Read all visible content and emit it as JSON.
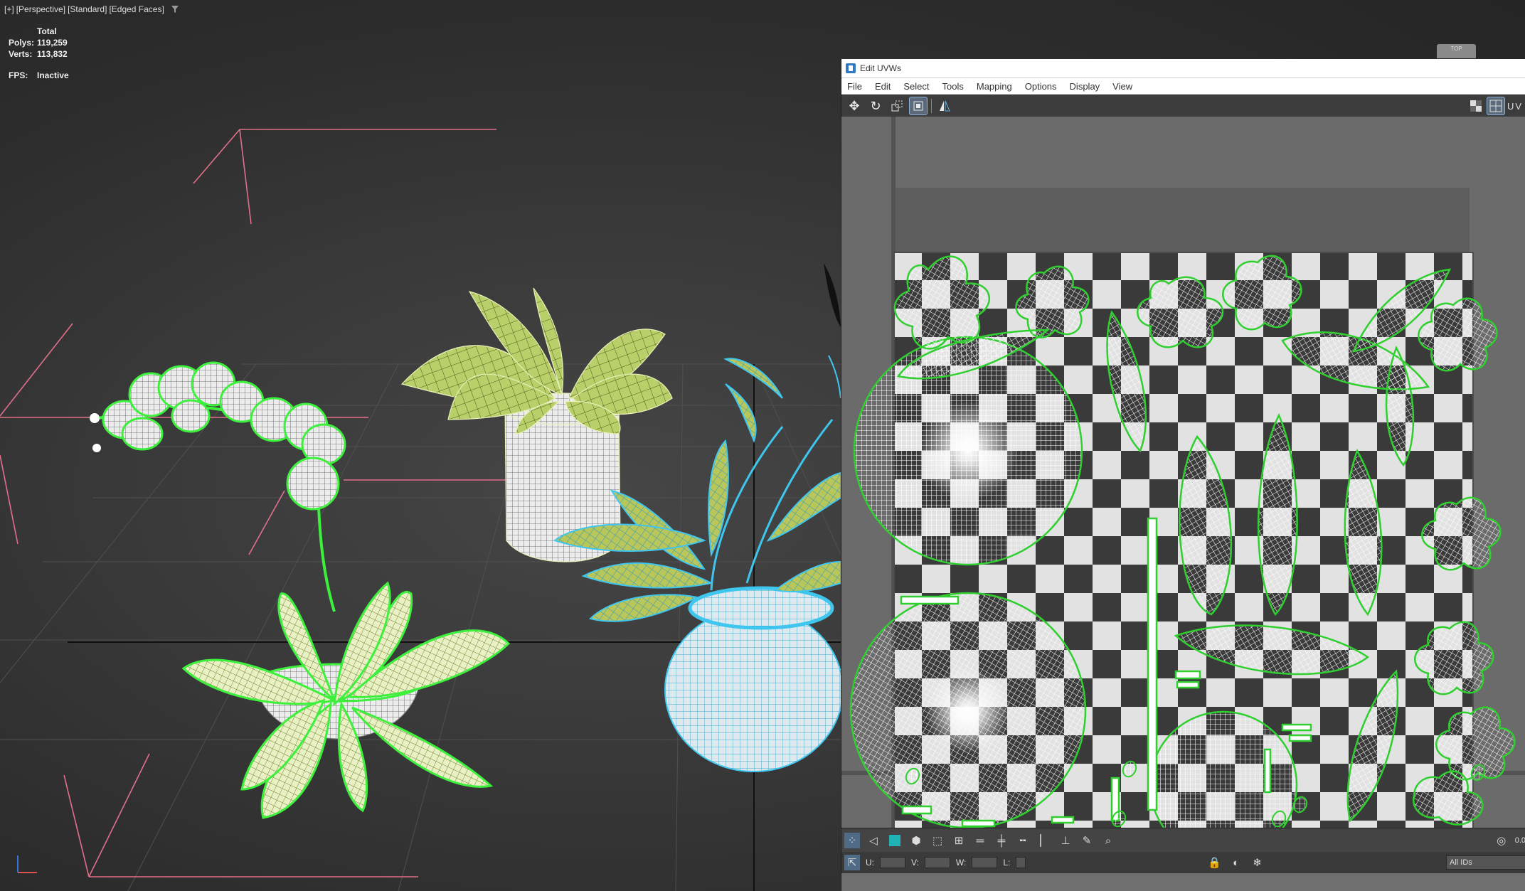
{
  "viewport": {
    "labels": [
      "[+]",
      "[Perspective]",
      "[Standard]",
      "[Edged Faces]"
    ],
    "stats": {
      "header": "Total",
      "polys_label": "Polys:",
      "polys_value": "119,259",
      "verts_label": "Verts:",
      "verts_value": "113,832",
      "fps_label": "FPS:",
      "fps_value": "Inactive"
    },
    "colors": {
      "selected_wire": "#3cf03c",
      "plant_wire": "#d8e8a0",
      "cyan_wire": "#3fc6ef",
      "gizmo": "#e0708a"
    }
  },
  "uvw": {
    "title": "Edit UVWs",
    "menu": [
      "File",
      "Edit",
      "Select",
      "Tools",
      "Mapping",
      "Options",
      "Display",
      "View"
    ],
    "toolbar": {
      "tools": [
        "move-icon",
        "rotate-icon",
        "scale-icon",
        "freeform-icon",
        "mirror-icon"
      ],
      "uv_label": "UV"
    },
    "bottom": {
      "u_label": "U:",
      "v_label": "V:",
      "w_label": "W:",
      "l_label": "L:",
      "ids": "All IDs",
      "right_value": "0.0"
    },
    "top_chip": "TOP"
  }
}
